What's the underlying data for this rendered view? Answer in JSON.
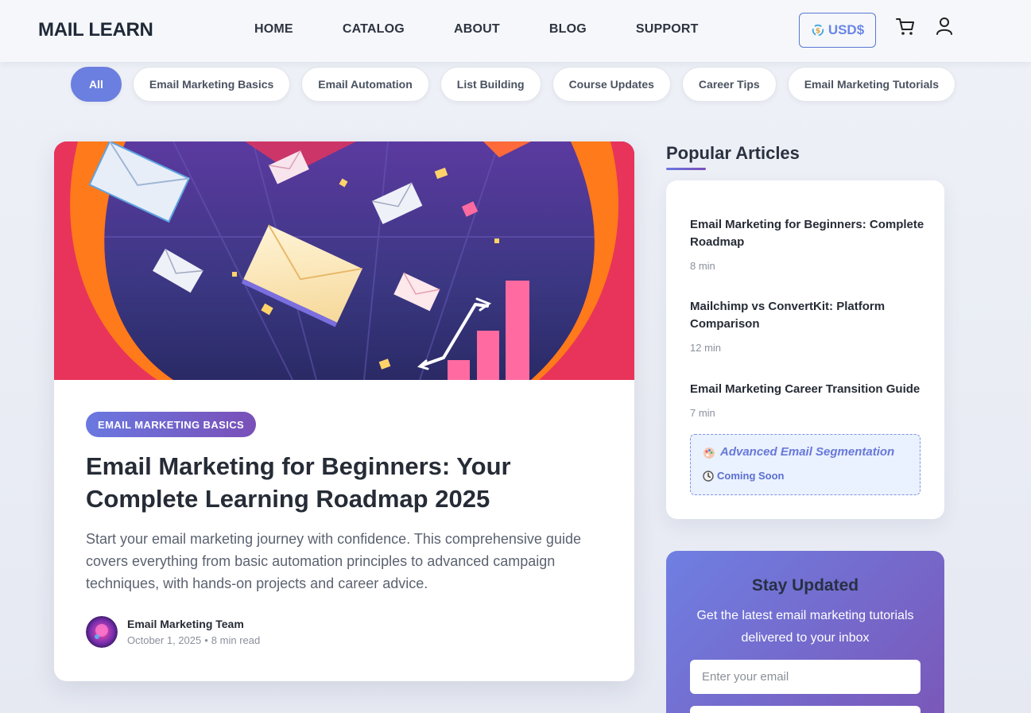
{
  "header": {
    "logo": "MAIL LEARN",
    "nav": [
      "HOME",
      "CATALOG",
      "ABOUT",
      "BLOG",
      "SUPPORT"
    ],
    "currency": "USD$"
  },
  "filters": [
    "All",
    "Email Marketing Basics",
    "Email Automation",
    "List Building",
    "Course Updates",
    "Career Tips",
    "Email Marketing Tutorials"
  ],
  "featured": {
    "category": "EMAIL MARKETING BASICS",
    "title": "Email Marketing for Beginners: Your Complete Learning Roadmap 2025",
    "excerpt": "Start your email marketing journey with confidence. This comprehensive guide covers everything from basic automation principles to advanced campaign techniques, with hands-on projects and career advice.",
    "author": "Email Marketing Team",
    "date": "October 1, 2025",
    "read_time": "8 min read"
  },
  "sidebar": {
    "popular_title": "Popular Articles",
    "articles": [
      {
        "title": "Email Marketing for Beginners: Complete Roadmap",
        "time": "8 min"
      },
      {
        "title": "Mailchimp vs ConvertKit: Platform Comparison",
        "time": "12 min"
      },
      {
        "title": "Email Marketing Career Transition Guide",
        "time": "7 min"
      }
    ],
    "coming_soon": {
      "title": "Advanced Email Segmentation",
      "status": "Coming Soon"
    }
  },
  "newsletter": {
    "title": "Stay Updated",
    "description": "Get the latest email marketing tutorials delivered to your inbox",
    "placeholder": "Enter your email"
  },
  "colors": {
    "accent": "#6b7fe0",
    "accent_dark": "#7a4fb8"
  }
}
